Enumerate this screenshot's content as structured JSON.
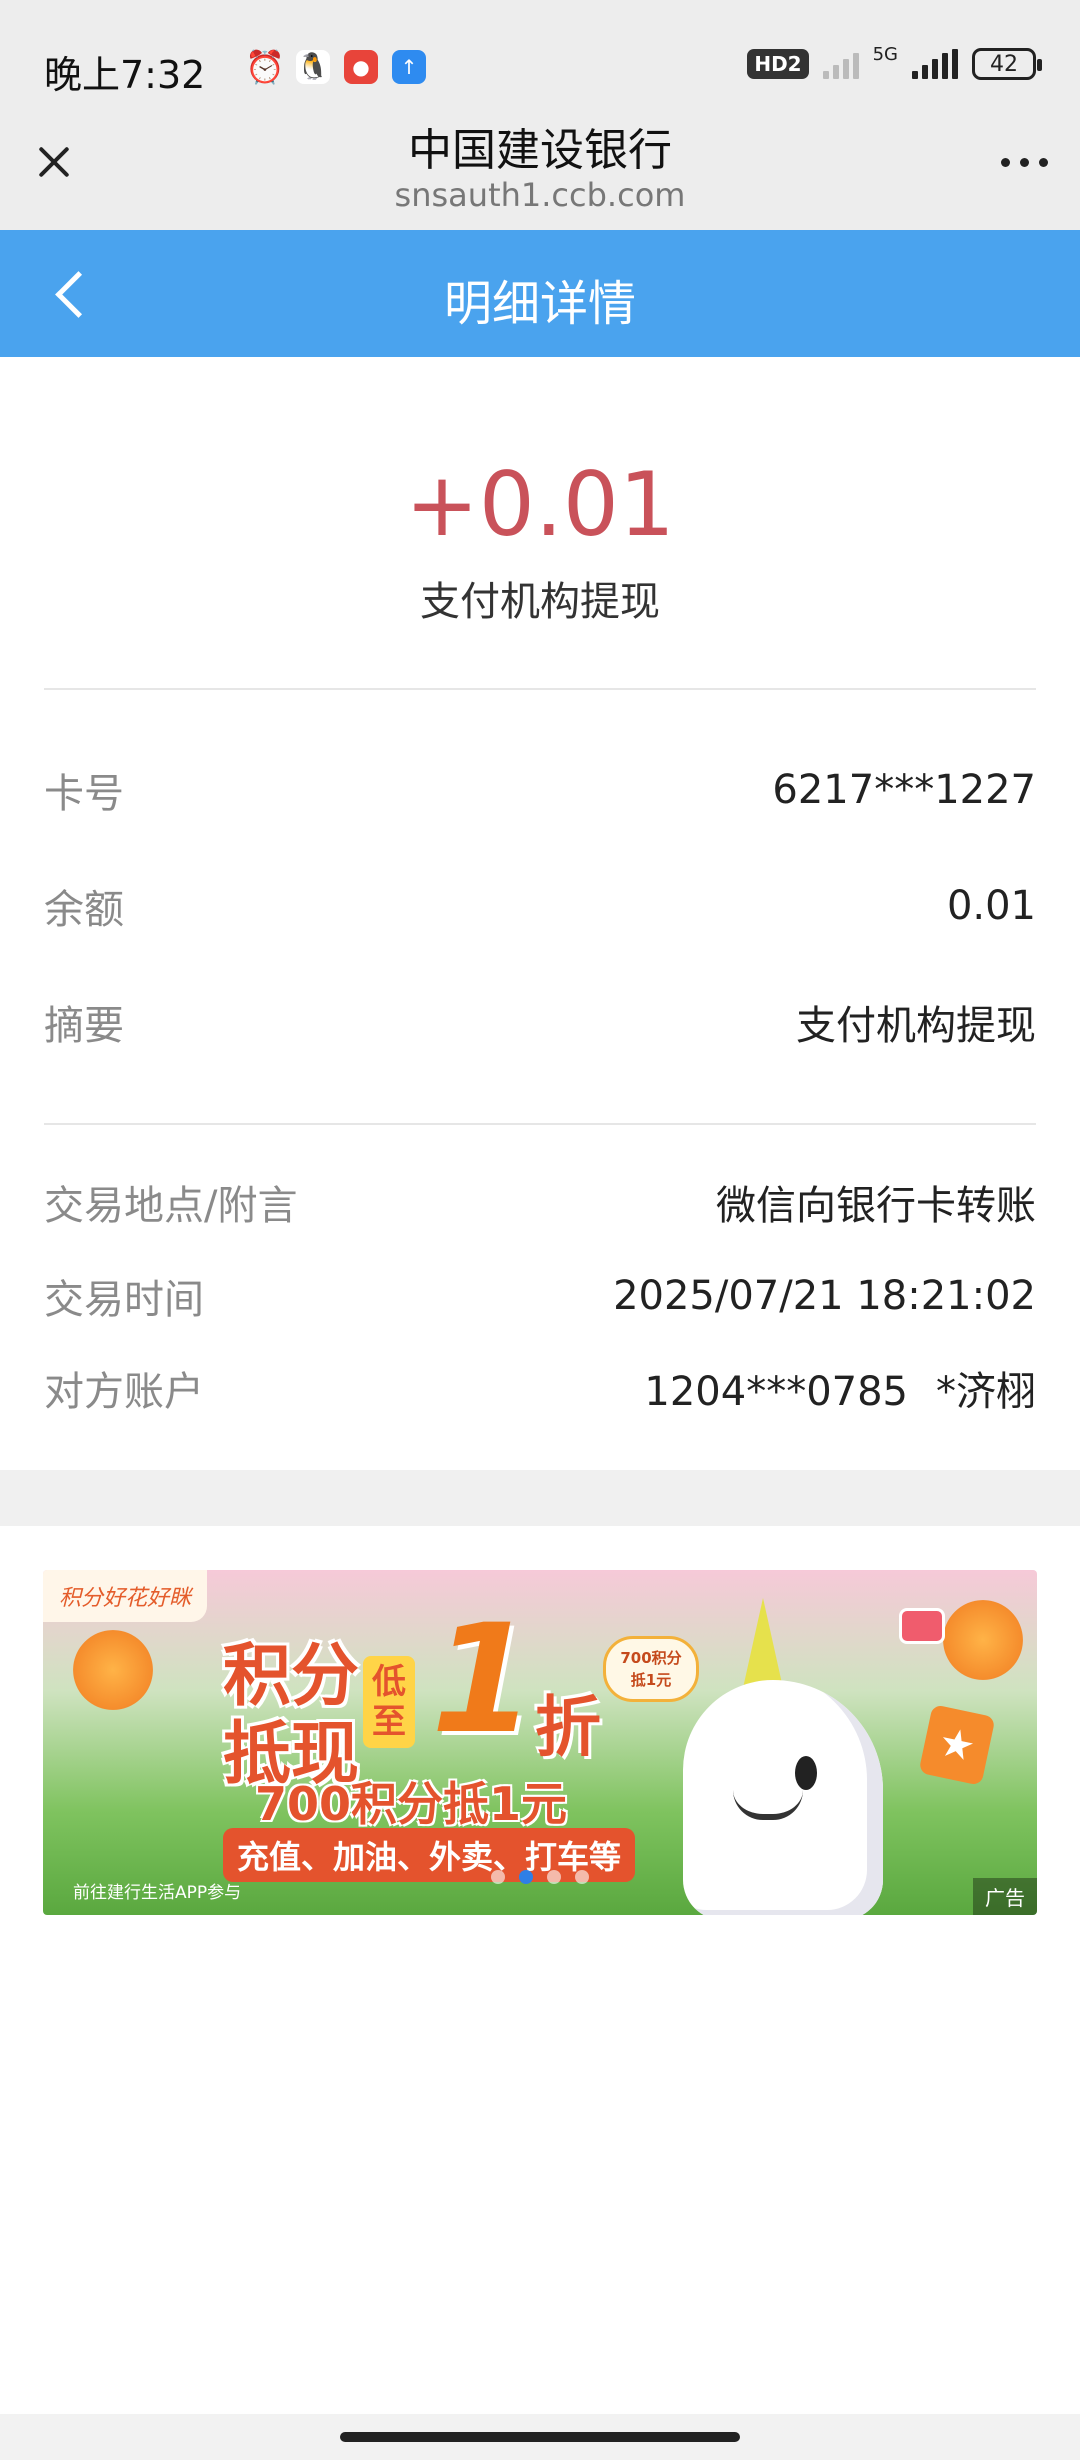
{
  "status_bar": {
    "time": "晚上7:32",
    "network_badge": "HD2",
    "network_type": "5G",
    "battery": "42"
  },
  "browser": {
    "title": "中国建设银行",
    "url": "snsauth1.ccb.com"
  },
  "page": {
    "title": "明细详情"
  },
  "transaction": {
    "amount": "+0.01",
    "description": "支付机构提现",
    "amount_color": "#c9525a"
  },
  "details": {
    "card_no": {
      "label": "卡号",
      "value": "6217***1227"
    },
    "balance": {
      "label": "余额",
      "value": "0.01"
    },
    "summary": {
      "label": "摘要",
      "value": "支付机构提现"
    },
    "location": {
      "label": "交易地点/附言",
      "value": "微信向银行卡转账"
    },
    "time": {
      "label": "交易时间",
      "value": "2025/07/21 18:21:02"
    },
    "counterparty": {
      "label": "对方账户",
      "account": "1204***0785",
      "name": "*济栩"
    }
  },
  "banner": {
    "tag": "积分好花好眯",
    "big_line": "积分\n抵现",
    "low_badge": "低至",
    "one": "1",
    "zhe": "折",
    "line1": "700积分抵1元",
    "line2": "充值、加油、外卖、打车等",
    "footnote": "前往建行生活APP参与",
    "bubble_line1": "700积分",
    "bubble_line2": "抵1元",
    "ad_label": "广告"
  },
  "colors": {
    "header_blue": "#4aa3ee",
    "status_bg": "#ededed"
  }
}
